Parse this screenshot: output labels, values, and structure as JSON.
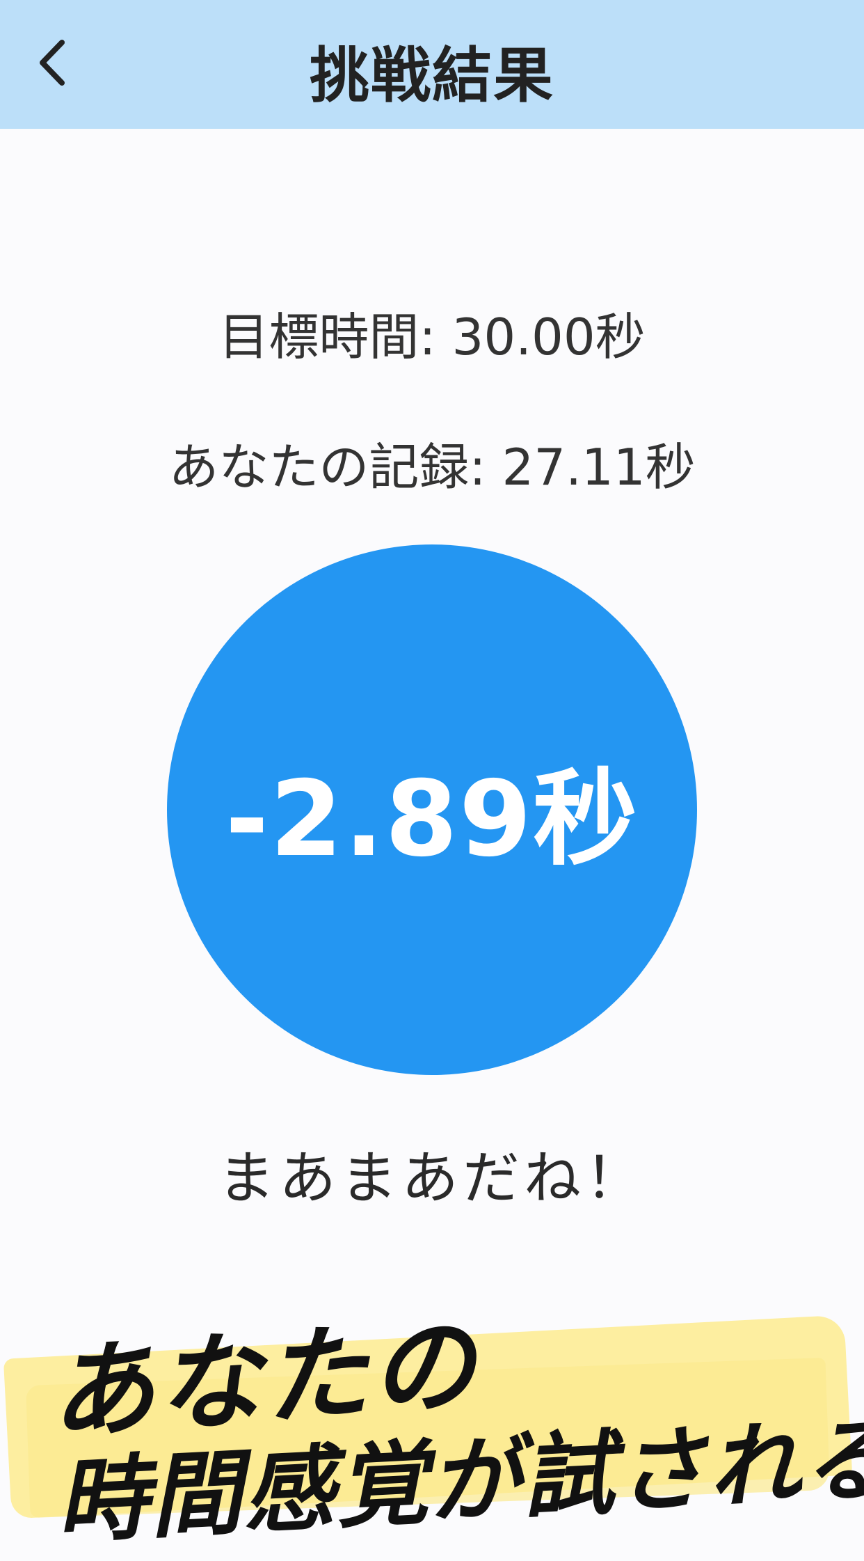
{
  "header": {
    "title": "挑戦結果",
    "back_icon": "chevron-left-icon"
  },
  "result": {
    "target_time": "目標時間: 30.00秒",
    "your_record": "あなたの記録: 27.11秒",
    "difference": "-2.89秒",
    "message": "まあまあだね！"
  },
  "promo": {
    "line1": "あなたの",
    "line2": "時間感覚が試される"
  },
  "colors": {
    "header_bg": "#bcdff9",
    "circle": "#2496f2",
    "highlight": "#fdeea0"
  }
}
